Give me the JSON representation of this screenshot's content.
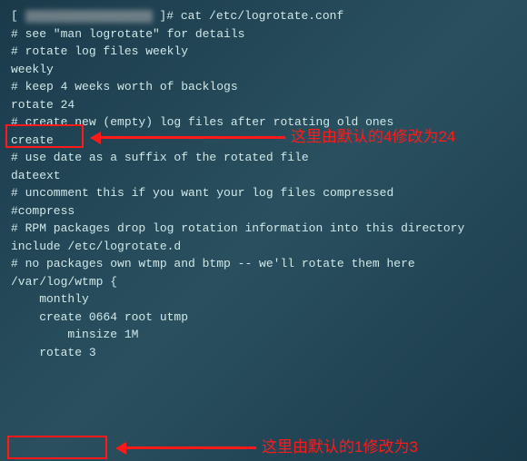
{
  "prompt_suffix": "]# cat /etc/logrotate.conf",
  "lines": {
    "l1": "# see \"man logrotate\" for details",
    "l2": "# rotate log files weekly",
    "l3": "weekly",
    "l4": "",
    "l5": "# keep 4 weeks worth of backlogs",
    "l6": "rotate 24",
    "l7": "",
    "l8": "# create new (empty) log files after rotating old ones",
    "l9": "create",
    "l10": "",
    "l11": "# use date as a suffix of the rotated file",
    "l12": "dateext",
    "l13": "",
    "l14": "# uncomment this if you want your log files compressed",
    "l15": "#compress",
    "l16": "",
    "l17": "# RPM packages drop log rotation information into this directory",
    "l18": "include /etc/logrotate.d",
    "l19": "",
    "l20": "# no packages own wtmp and btmp -- we'll rotate them here",
    "l21": "/var/log/wtmp {",
    "l22": "    monthly",
    "l23": "    create 0664 root utmp",
    "l24": "        minsize 1M",
    "l25": "    rotate 3"
  },
  "annotations": {
    "a1": "这里由默认的4修改为24",
    "a2": "这里由默认的1修改为3"
  }
}
